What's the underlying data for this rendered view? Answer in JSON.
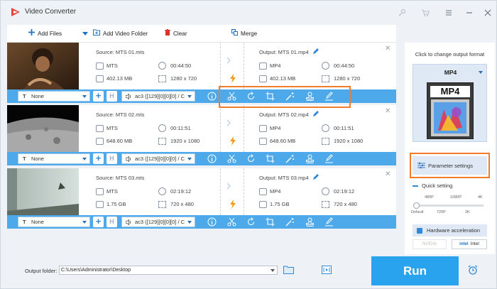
{
  "app": {
    "title": "Video Converter"
  },
  "toolbar": {
    "add_files": "Add Files",
    "add_video_folder": "Add Video Folder",
    "clear": "Clear",
    "merge": "Merge"
  },
  "rows": [
    {
      "source": "Source: MTS 01.mts",
      "output": "Output: MTS 01.mp4",
      "in_format": "MTS",
      "in_duration": "00:44:50",
      "in_size": "402.13 MB",
      "in_res": "1280 x 720",
      "out_format": "MP4",
      "out_duration": "00:44:50",
      "out_size": "402.13 MB",
      "out_res": "1280 x 720",
      "subtitle": "None",
      "audio": "ac3 ([129][0][0][0] / C"
    },
    {
      "source": "Source: MTS 02.mts",
      "output": "Output: MTS 02.mp4",
      "in_format": "MTS",
      "in_duration": "00:11:51",
      "in_size": "648.60 MB",
      "in_res": "1920 x 1080",
      "out_format": "MP4",
      "out_duration": "00:11:51",
      "out_size": "648.60 MB",
      "out_res": "1920 x 1080",
      "subtitle": "None",
      "audio": "ac3 ([129][0][0][0] / C"
    },
    {
      "source": "Source: MTS 03.mts",
      "output": "Output: MTS 03.mp4",
      "in_format": "MTS",
      "in_duration": "02:19:12",
      "in_size": "1.75 GB",
      "in_res": "720 x 480",
      "out_format": "MP4",
      "out_duration": "02:19:12",
      "out_size": "1.75 GB",
      "out_res": "720 x 480",
      "subtitle": "None",
      "audio": "ac3 ([129][0][0][0] / C"
    }
  ],
  "right_panel": {
    "title": "Click to change output format",
    "format": "MP4",
    "format_badge": "MP4",
    "param_settings": "Parameter settings",
    "quick_setting": "Quick setting",
    "ticks_top": [
      "480P",
      "1080P",
      "4K"
    ],
    "ticks_bottom": [
      "Default",
      "720P",
      "2K"
    ],
    "hw_accel": "Hardware acceleration",
    "gpu_nvidia": "NVIDIA",
    "gpu_intel": "Intel"
  },
  "bottom": {
    "output_folder_label": "Output folder:",
    "output_folder_path": "C:\\Users\\Administrator\\Desktop",
    "run": "Run"
  },
  "colors": {
    "accent": "#4da9ea",
    "run": "#2aa3ee",
    "highlight": "#ef7d2c",
    "lightning": "#f59a1b"
  }
}
